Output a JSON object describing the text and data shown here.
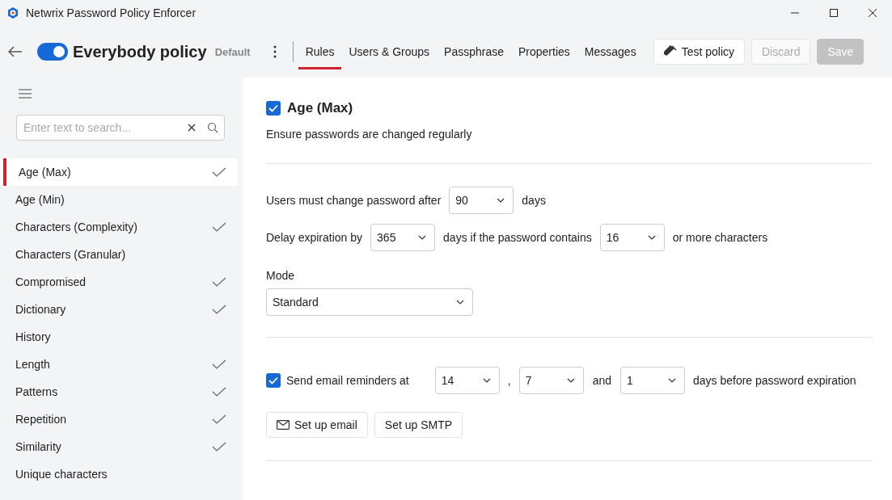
{
  "window": {
    "title": "Netwrix Password Policy Enforcer"
  },
  "header": {
    "enabled": true,
    "policy_name": "Everybody policy",
    "badge": "Default",
    "tabs": [
      {
        "label": "Rules",
        "selected": true
      },
      {
        "label": "Users & Groups",
        "selected": false
      },
      {
        "label": "Passphrase",
        "selected": false
      },
      {
        "label": "Properties",
        "selected": false
      },
      {
        "label": "Messages",
        "selected": false
      }
    ],
    "buttons": [
      {
        "label": "Test policy",
        "kind": "test",
        "disabled": false
      },
      {
        "label": "Discard",
        "kind": "secondary",
        "disabled": true
      },
      {
        "label": "Save",
        "kind": "primary",
        "disabled": true
      }
    ]
  },
  "sidebar": {
    "search": {
      "placeholder": "Enter text to search..."
    },
    "items": [
      {
        "label": "Age (Max)",
        "selected": true,
        "checked": true
      },
      {
        "label": "Age (Min)",
        "selected": false,
        "checked": false
      },
      {
        "label": "Characters (Complexity)",
        "selected": false,
        "checked": true
      },
      {
        "label": "Characters (Granular)",
        "selected": false,
        "checked": false
      },
      {
        "label": "Compromised",
        "selected": false,
        "checked": true
      },
      {
        "label": "Dictionary",
        "selected": false,
        "checked": true
      },
      {
        "label": "History",
        "selected": false,
        "checked": false
      },
      {
        "label": "Length",
        "selected": false,
        "checked": true
      },
      {
        "label": "Patterns",
        "selected": false,
        "checked": true
      },
      {
        "label": "Repetition",
        "selected": false,
        "checked": true
      },
      {
        "label": "Similarity",
        "selected": false,
        "checked": true
      },
      {
        "label": "Unique characters",
        "selected": false,
        "checked": false
      }
    ]
  },
  "rule": {
    "title": "Age (Max)",
    "enabled": true,
    "description": "Ensure passwords are changed regularly",
    "change_after": {
      "label": "Users must change password after",
      "value": "90",
      "unit": "days"
    },
    "delay": {
      "label": "Delay expiration by",
      "value": "365",
      "middle": "days if the password contains",
      "chars": "16",
      "suffix": "or more characters"
    },
    "mode": {
      "label": "Mode",
      "value": "Standard"
    },
    "reminders": {
      "checked": true,
      "label": "Send email reminders at",
      "first": "14",
      "comma": ",",
      "second": "7",
      "and": "and",
      "third": "1",
      "suffix": "days before password expiration"
    },
    "actions": [
      {
        "label": "Set up email",
        "kind": "email"
      },
      {
        "label": "Set up SMTP",
        "kind": "plain"
      }
    ]
  }
}
